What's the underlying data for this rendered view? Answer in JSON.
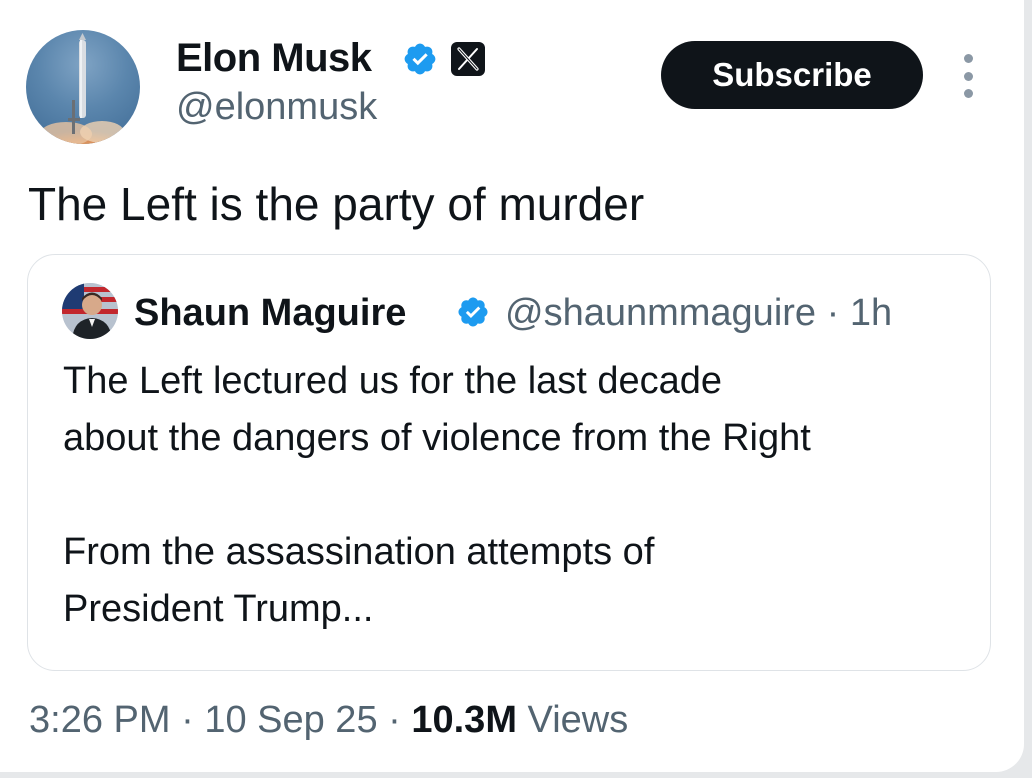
{
  "author": {
    "name": "Elon Musk",
    "handle": "@elonmusk",
    "avatar_icon": "rocket-launch-avatar",
    "verified_color": "#1d9bf0"
  },
  "actions": {
    "subscribe_label": "Subscribe",
    "more_icon": "vertical-dots-icon"
  },
  "tweet": {
    "text": "The Left is the party of murder"
  },
  "quoted_tweet": {
    "name": "Shaun Maguire",
    "handle": "@shaunmmaguire",
    "separator": "·",
    "time": "1h",
    "body_lines": [
      "The Left lectured us for the last decade",
      "about the dangers of violence from the Right",
      "From the assassination attempts of",
      "President Trump..."
    ]
  },
  "footer": {
    "time": "3:26 PM",
    "separator": "·",
    "date": "10 Sep 25",
    "views_count": "10.3M",
    "views_label": "Views"
  }
}
